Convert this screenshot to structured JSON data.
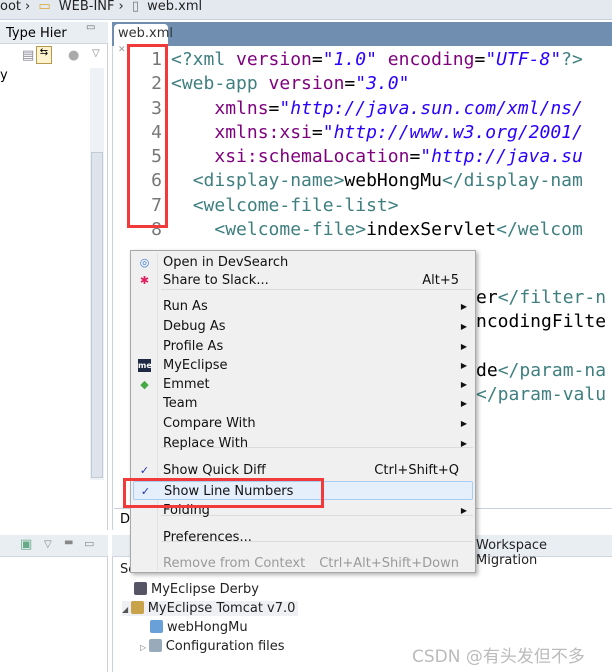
{
  "breadcrumb": [
    "oot",
    "WEB-INF",
    "web.xml"
  ],
  "left_panel": {
    "tab": "Type Hier",
    "text": "y"
  },
  "editor": {
    "tab": "web.xml",
    "line_numbers": [
      "1",
      "2",
      "3",
      "4",
      "5",
      "6",
      "7",
      "8"
    ],
    "lines": [
      [
        [
          "t",
          "<?xml "
        ],
        [
          "a",
          "version"
        ],
        [
          "x",
          "="
        ],
        [
          "s",
          "\"1.0\""
        ],
        [
          "x",
          " "
        ],
        [
          "a",
          "encoding"
        ],
        [
          "x",
          "="
        ],
        [
          "s",
          "\"UTF-8\""
        ],
        [
          "t",
          "?>"
        ]
      ],
      [
        [
          "t",
          "<web-app "
        ],
        [
          "a",
          "version"
        ],
        [
          "x",
          "="
        ],
        [
          "s",
          "\"3.0\""
        ]
      ],
      [
        [
          "x",
          "    "
        ],
        [
          "a",
          "xmlns"
        ],
        [
          "x",
          "="
        ],
        [
          "s",
          "\"http://java.sun.com/xml/ns/"
        ]
      ],
      [
        [
          "x",
          "    "
        ],
        [
          "a",
          "xmlns:xsi"
        ],
        [
          "x",
          "="
        ],
        [
          "s",
          "\"http://www.w3.org/2001/"
        ]
      ],
      [
        [
          "x",
          "    "
        ],
        [
          "a",
          "xsi:schemaLocation"
        ],
        [
          "x",
          "="
        ],
        [
          "s",
          "\"http://java.su"
        ]
      ],
      [
        [
          "x",
          "  "
        ],
        [
          "t",
          "<display-name>"
        ],
        [
          "x",
          "webHongMu"
        ],
        [
          "t",
          "</display-nam"
        ]
      ],
      [
        [
          "x",
          "  "
        ],
        [
          "t",
          "<welcome-file-list>"
        ]
      ],
      [
        [
          "x",
          "    "
        ],
        [
          "t",
          "<welcome-file>"
        ],
        [
          "x",
          "indexServlet"
        ],
        [
          "t",
          "</welcom"
        ]
      ]
    ],
    "partial_lines": [
      [
        [
          "x",
          "er"
        ],
        [
          "t",
          "</filter-n"
        ]
      ],
      [
        [
          "x",
          "ncodingFilte"
        ]
      ],
      [],
      [
        [
          "x",
          "de"
        ],
        [
          "t",
          "</param-na"
        ]
      ],
      [
        [
          "t",
          "</param-valu"
        ]
      ]
    ],
    "bottom_tab": "De"
  },
  "context_menu": [
    {
      "label": "Open in DevSearch",
      "icon": "devsearch-icon"
    },
    {
      "label": "Share to Slack...",
      "shortcut": "Alt+5",
      "icon": "slack-icon"
    },
    {
      "label": "Run As",
      "submenu": true
    },
    {
      "label": "Debug As",
      "submenu": true
    },
    {
      "label": "Profile As",
      "submenu": true
    },
    {
      "label": "MyEclipse",
      "submenu": true,
      "icon": "myeclipse-icon"
    },
    {
      "label": "Emmet",
      "submenu": true,
      "icon": "emmet-icon"
    },
    {
      "label": "Team",
      "submenu": true
    },
    {
      "label": "Compare With",
      "submenu": true
    },
    {
      "label": "Replace With",
      "submenu": true
    },
    {
      "label": "Show Quick Diff",
      "shortcut": "Ctrl+Shift+Q",
      "checked": true
    },
    {
      "label": "Show Line Numbers",
      "checked": true,
      "highlighted": true
    },
    {
      "label": "Folding",
      "submenu": true
    },
    {
      "label": "Preferences..."
    },
    {
      "label": "Remove from Context",
      "shortcut": "Ctrl+Alt+Shift+Down",
      "disabled": true
    }
  ],
  "bottom_panel": {
    "tab": "Workspace Migration",
    "section": "Serv",
    "tree": [
      {
        "label": "MyEclipse Derby"
      },
      {
        "label": "MyEclipse Tomcat v7.0",
        "expanded": true
      },
      {
        "label": "webHongMu"
      },
      {
        "label": "Configuration files",
        "collapsed": true
      }
    ]
  },
  "watermark": "CSDN @有头发但不多",
  "colors": {
    "highlight_box": "#f23a3a",
    "tag": "#3f7f7f",
    "attr": "#7f007f",
    "string": "#2a00ff"
  }
}
